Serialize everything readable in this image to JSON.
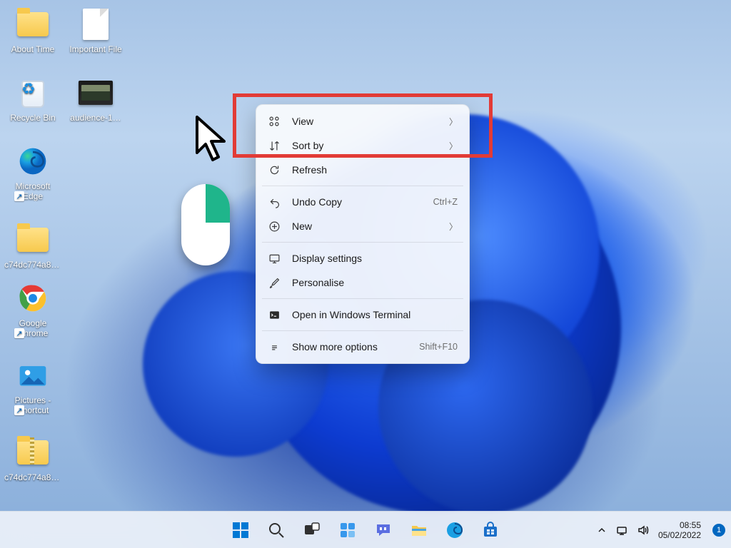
{
  "desktop_icons": [
    {
      "name": "about-time",
      "label": "About Time"
    },
    {
      "name": "important-file",
      "label": "Important File"
    },
    {
      "name": "recycle-bin",
      "label": "Recycle Bin"
    },
    {
      "name": "audience",
      "label": "audience-1…"
    },
    {
      "name": "edge",
      "label": "Microsoft Edge"
    },
    {
      "name": "folder-c74",
      "label": "c74dc774a8f…"
    },
    {
      "name": "chrome",
      "label": "Google Chrome"
    },
    {
      "name": "pictures-shortcut",
      "label": "Pictures - Shortcut"
    },
    {
      "name": "zip-c74",
      "label": "c74dc774a8f…"
    }
  ],
  "context_menu": {
    "view": "View",
    "sort_by": "Sort by",
    "refresh": "Refresh",
    "undo_copy": "Undo Copy",
    "undo_copy_hint": "Ctrl+Z",
    "new": "New",
    "display_settings": "Display settings",
    "personalise": "Personalise",
    "open_terminal": "Open in Windows Terminal",
    "show_more": "Show more options",
    "show_more_hint": "Shift+F10"
  },
  "systray": {
    "time": "08:55",
    "date": "05/02/2022",
    "notif_count": "1"
  }
}
